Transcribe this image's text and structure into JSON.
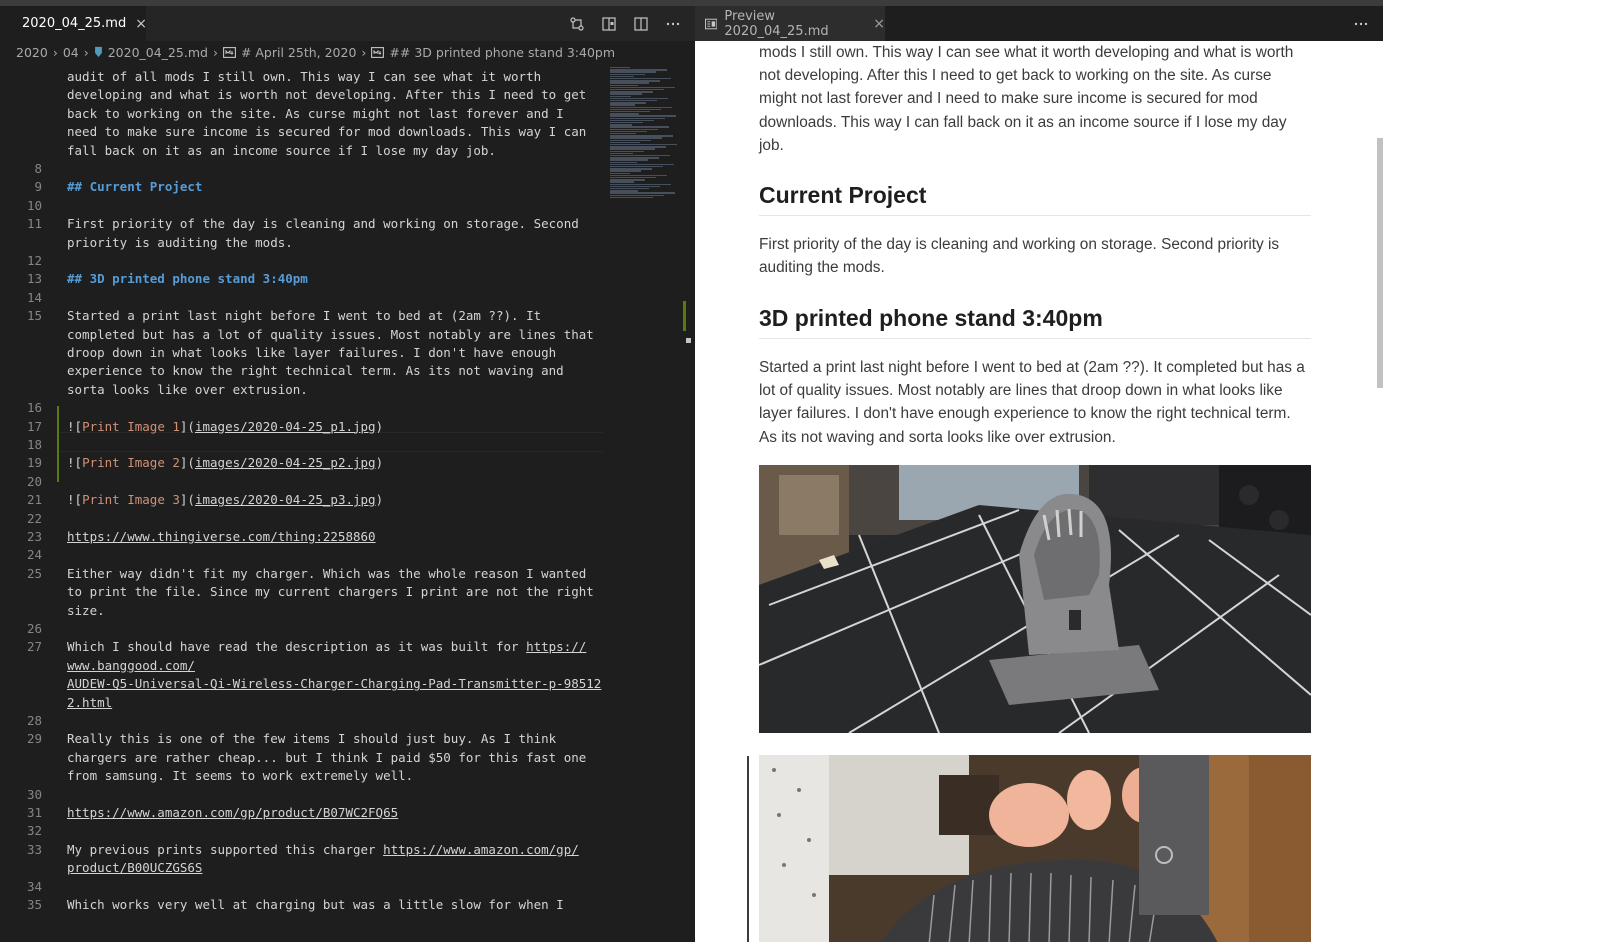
{
  "editor": {
    "tab": {
      "label": "2020_04_25.md",
      "close": "×"
    },
    "breadcrumb": [
      {
        "label": "2020"
      },
      {
        "label": "04"
      },
      {
        "label": "2020_04_25.md"
      },
      {
        "label": "# April 25th, 2020"
      },
      {
        "label": "## 3D printed phone stand 3:40pm"
      }
    ],
    "lines": [
      {
        "n": "",
        "segs": [
          {
            "t": "audit of all mods I still own. This way I can see what it worth"
          }
        ]
      },
      {
        "n": "",
        "segs": [
          {
            "t": "developing and what is worth not developing. After this I need to get"
          }
        ]
      },
      {
        "n": "",
        "segs": [
          {
            "t": "back to working on the site. As curse might not last forever and I"
          }
        ]
      },
      {
        "n": "",
        "segs": [
          {
            "t": "need to make sure income is secured for mod downloads. This way I can"
          }
        ]
      },
      {
        "n": "",
        "segs": [
          {
            "t": "fall back on it as an income source if I lose my day job."
          }
        ]
      },
      {
        "n": "8",
        "segs": []
      },
      {
        "n": "9",
        "segs": [
          {
            "t": "## Current Project",
            "c": "heading"
          }
        ]
      },
      {
        "n": "10",
        "segs": []
      },
      {
        "n": "11",
        "segs": [
          {
            "t": "First priority of the day is cleaning and working on storage. Second"
          }
        ]
      },
      {
        "n": "",
        "segs": [
          {
            "t": "priority is auditing the mods."
          }
        ]
      },
      {
        "n": "12",
        "segs": []
      },
      {
        "n": "13",
        "segs": [
          {
            "t": "## 3D printed phone stand 3:40pm",
            "c": "heading"
          }
        ]
      },
      {
        "n": "14",
        "segs": []
      },
      {
        "n": "15",
        "segs": [
          {
            "t": "Started a print last night before I went to bed at (2am ??). It"
          }
        ]
      },
      {
        "n": "",
        "segs": [
          {
            "t": "completed but has a lot of quality issues. Most notably are lines that"
          }
        ]
      },
      {
        "n": "",
        "segs": [
          {
            "t": "droop down in what looks like layer failures. I don't have enough"
          }
        ]
      },
      {
        "n": "",
        "segs": [
          {
            "t": "experience to know the right technical term. As its not waving and"
          }
        ]
      },
      {
        "n": "",
        "segs": [
          {
            "t": "sorta looks like over extrusion."
          }
        ]
      },
      {
        "n": "16",
        "segs": []
      },
      {
        "n": "17",
        "segs": [
          {
            "t": "!["
          },
          {
            "t": "Print Image 1",
            "c": "alt"
          },
          {
            "t": "]("
          },
          {
            "t": "images/2020-04-25_p1.jpg",
            "c": "link"
          },
          {
            "t": ")"
          }
        ]
      },
      {
        "n": "18",
        "segs": []
      },
      {
        "n": "19",
        "segs": [
          {
            "t": "!["
          },
          {
            "t": "Print Image 2",
            "c": "alt"
          },
          {
            "t": "]("
          },
          {
            "t": "images/2020-04-25_p2.jpg",
            "c": "link"
          },
          {
            "t": ")"
          }
        ]
      },
      {
        "n": "20",
        "segs": []
      },
      {
        "n": "21",
        "segs": [
          {
            "t": "!["
          },
          {
            "t": "Print Image 3",
            "c": "alt"
          },
          {
            "t": "]("
          },
          {
            "t": "images/2020-04-25_p3.jpg",
            "c": "link"
          },
          {
            "t": ")"
          }
        ]
      },
      {
        "n": "22",
        "segs": []
      },
      {
        "n": "23",
        "segs": [
          {
            "t": "https://www.thingiverse.com/thing:2258860",
            "c": "link"
          }
        ]
      },
      {
        "n": "24",
        "segs": []
      },
      {
        "n": "25",
        "segs": [
          {
            "t": "Either way didn't fit my charger. Which was the whole reason I wanted"
          }
        ]
      },
      {
        "n": "",
        "segs": [
          {
            "t": "to print the file. Since my current chargers I print are not the right"
          }
        ]
      },
      {
        "n": "",
        "segs": [
          {
            "t": "size."
          }
        ]
      },
      {
        "n": "26",
        "segs": []
      },
      {
        "n": "27",
        "segs": [
          {
            "t": "Which I should have read the description as it was built for "
          },
          {
            "t": "https://",
            "c": "link"
          }
        ]
      },
      {
        "n": "",
        "segs": [
          {
            "t": "www.banggood.com/",
            "c": "link"
          }
        ]
      },
      {
        "n": "",
        "segs": [
          {
            "t": "AUDEW-Q5-Universal-Qi-Wireless-Charger-Charging-Pad-Transmitter-p-98512",
            "c": "link"
          }
        ]
      },
      {
        "n": "",
        "segs": [
          {
            "t": "2.html",
            "c": "link"
          }
        ]
      },
      {
        "n": "28",
        "segs": []
      },
      {
        "n": "29",
        "segs": [
          {
            "t": "Really this is one of the few items I should just buy. As I think"
          }
        ]
      },
      {
        "n": "",
        "segs": [
          {
            "t": "chargers are rather cheap... but I think I paid $50 for this fast one"
          }
        ]
      },
      {
        "n": "",
        "segs": [
          {
            "t": "from samsung. It seems to work extremely well."
          }
        ]
      },
      {
        "n": "30",
        "segs": []
      },
      {
        "n": "31",
        "segs": [
          {
            "t": "https://www.amazon.com/gp/product/B07WC2FQ65",
            "c": "link"
          }
        ]
      },
      {
        "n": "32",
        "segs": []
      },
      {
        "n": "33",
        "segs": [
          {
            "t": "My previous prints supported this charger "
          },
          {
            "t": "https://www.amazon.com/gp/",
            "c": "link"
          }
        ]
      },
      {
        "n": "",
        "segs": [
          {
            "t": "product/B00UCZGS6S",
            "c": "link"
          }
        ]
      },
      {
        "n": "34",
        "segs": []
      },
      {
        "n": "35",
        "segs": [
          {
            "t": "Which works very well at charging but was a little slow for when I"
          }
        ]
      }
    ]
  },
  "preview": {
    "tab": {
      "label": "Preview 2020_04_25.md",
      "close": "×"
    },
    "para1": "mods I still own. This way I can see what it worth developing and what is worth not developing. After this I need to get back to working on the site. As curse might not last forever and I need to make sure income is secured for mod downloads. This way I can fall back on it as an income source if I lose my day job.",
    "h_current": "Current Project",
    "para2": "First priority of the day is cleaning and working on storage. Second priority is auditing the mods.",
    "h_print": "3D printed phone stand 3:40pm",
    "para3": "Started a print last night before I went to bed at (2am ??). It completed but has a lot of quality issues. Most notably are lines that droop down in what looks like layer failures. I don't have enough experience to know the right technical term. As its not waving and sorta looks like over extrusion."
  },
  "colors": {
    "heading": "#569cd6",
    "alt_text": "#ce9178",
    "git_added": "#587c0c",
    "editor_bg": "#1e1e1e"
  }
}
